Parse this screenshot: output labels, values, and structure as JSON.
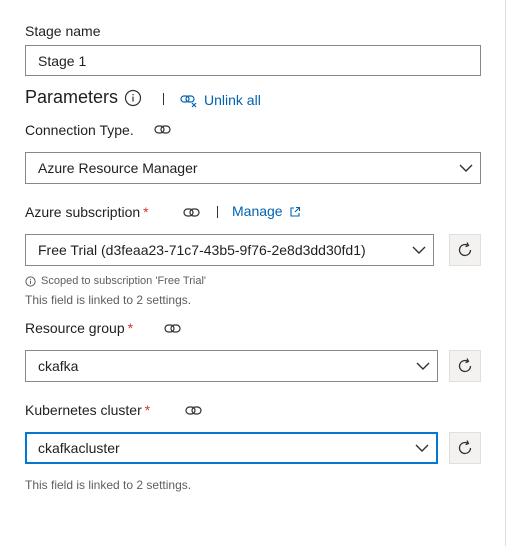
{
  "stage_name": {
    "label": "Stage name",
    "value": "Stage 1"
  },
  "parameters": {
    "heading": "Parameters",
    "unlink_all": "Unlink all"
  },
  "connection_type": {
    "label": "Connection Type.",
    "value": "Azure Resource Manager"
  },
  "azure_subscription": {
    "label": "Azure subscription",
    "required_mark": "*",
    "manage_label": "Manage",
    "value": "Free Trial (d3feaa23-71c7-43b5-9f76-2e8d3dd30fd1)",
    "scoped_note": "Scoped to subscription 'Free Trial'",
    "linked_note": "This field is linked to 2 settings."
  },
  "resource_group": {
    "label": "Resource group",
    "required_mark": "*",
    "value": "ckafka"
  },
  "kubernetes_cluster": {
    "label": "Kubernetes cluster",
    "required_mark": "*",
    "value": "ckafkacluster",
    "linked_note": "This field is linked to 2 settings."
  },
  "colors": {
    "accent": "#0078d4",
    "link": "#0063b1",
    "required": "#d13438",
    "helper_text": "#605e5c"
  },
  "icons": {
    "info": "info-icon",
    "link": "link-icon",
    "unlink": "unlink-icon",
    "external": "open-external-icon",
    "chevron": "chevron-down-icon",
    "refresh": "refresh-icon"
  }
}
